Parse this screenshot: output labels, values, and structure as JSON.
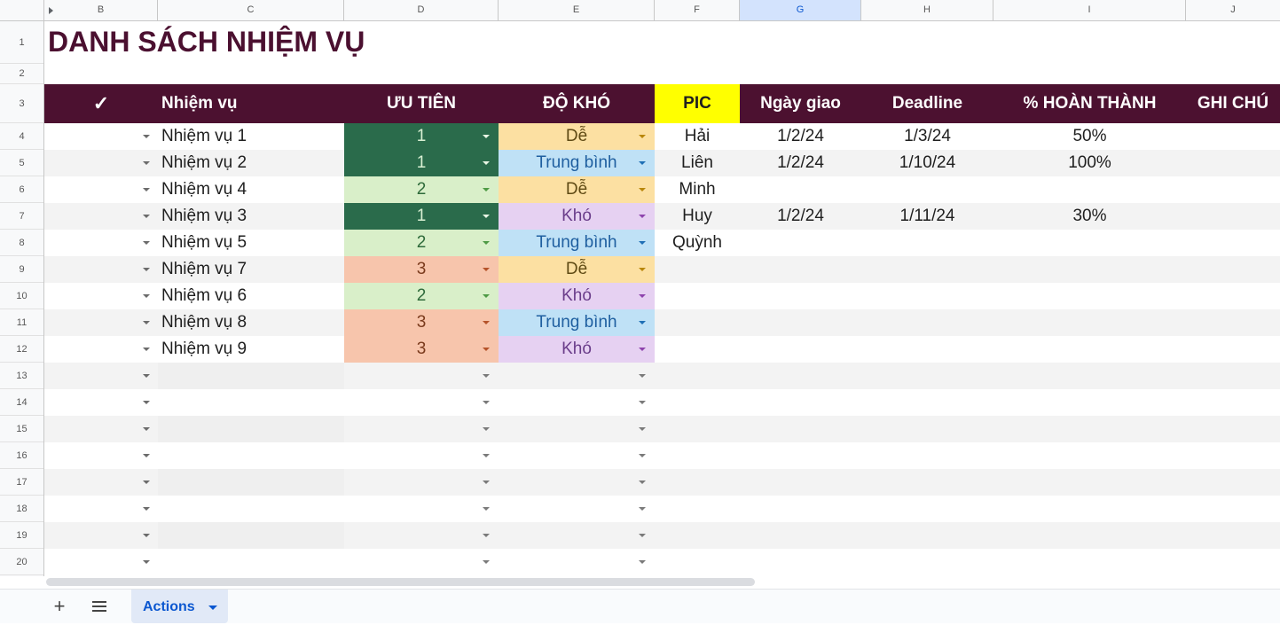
{
  "columns": [
    "B",
    "C",
    "D",
    "E",
    "F",
    "G",
    "H",
    "I",
    "J"
  ],
  "rows": [
    "1",
    "2",
    "3",
    "4",
    "5",
    "6",
    "7",
    "8",
    "9",
    "10",
    "11",
    "12",
    "13",
    "14",
    "15",
    "16",
    "17",
    "18",
    "19",
    "20"
  ],
  "title": "DANH SÁCH NHIỆM VỤ",
  "headers": {
    "check": "✓",
    "task": "Nhiệm vụ",
    "priority": "ƯU TIÊN",
    "difficulty": "ĐỘ KHÓ",
    "pic": "PIC",
    "assigned": "Ngày giao",
    "deadline": "Deadline",
    "percent": "% HOÀN THÀNH",
    "note": "GHI CHÚ"
  },
  "tasks": [
    {
      "name": "Nhiệm vụ 1",
      "priority": "1",
      "difficulty": "Dễ",
      "pic": "Hải",
      "assigned": "1/2/24",
      "deadline": "1/3/24",
      "percent": "50%"
    },
    {
      "name": "Nhiệm vụ 2",
      "priority": "1",
      "difficulty": "Trung bình",
      "pic": "Liên",
      "assigned": "1/2/24",
      "deadline": "1/10/24",
      "percent": "100%"
    },
    {
      "name": "Nhiệm vụ 4",
      "priority": "2",
      "difficulty": "Dễ",
      "pic": "Minh",
      "assigned": "",
      "deadline": "",
      "percent": ""
    },
    {
      "name": "Nhiệm vụ 3",
      "priority": "1",
      "difficulty": "Khó",
      "pic": "Huy",
      "assigned": "1/2/24",
      "deadline": "1/11/24",
      "percent": "30%"
    },
    {
      "name": "Nhiệm vụ 5",
      "priority": "2",
      "difficulty": "Trung bình",
      "pic": "Quỳnh",
      "assigned": "",
      "deadline": "",
      "percent": ""
    },
    {
      "name": "Nhiệm vụ 7",
      "priority": "3",
      "difficulty": "Dễ",
      "pic": "",
      "assigned": "",
      "deadline": "",
      "percent": ""
    },
    {
      "name": "Nhiệm vụ 6",
      "priority": "2",
      "difficulty": "Khó",
      "pic": "",
      "assigned": "",
      "deadline": "",
      "percent": ""
    },
    {
      "name": "Nhiệm vụ 8",
      "priority": "3",
      "difficulty": "Trung bình",
      "pic": "",
      "assigned": "",
      "deadline": "",
      "percent": ""
    },
    {
      "name": "Nhiệm vụ 9",
      "priority": "3",
      "difficulty": "Khó",
      "pic": "",
      "assigned": "",
      "deadline": "",
      "percent": ""
    }
  ],
  "colors": {
    "header_bg": "#4c1130",
    "pic_header_bg": "#ffff00",
    "priority": {
      "1": {
        "bg": "#2a6b4b",
        "fg": "#d9f0d3",
        "caret": "#e8f5e4"
      },
      "2": {
        "bg": "#d9efc9",
        "fg": "#2e6a3a",
        "caret": "#4e9a45"
      },
      "3": {
        "bg": "#f7c5ac",
        "fg": "#7a3a1c",
        "caret": "#b5532a"
      }
    },
    "difficulty": {
      "Dễ": {
        "bg": "#fce0a2",
        "fg": "#5f4a14",
        "caret": "#b8860b"
      },
      "Trung bình": {
        "bg": "#bfe1f6",
        "fg": "#1f5fa0",
        "caret": "#1f6fb5"
      },
      "Khó": {
        "bg": "#e6d1f2",
        "fg": "#6a3d8a",
        "caret": "#8e44ad"
      }
    }
  },
  "sheet_tabs": [
    {
      "label": "Actions",
      "active": true
    }
  ],
  "icons": {
    "add": "plus-icon",
    "menu": "all-sheets-icon"
  }
}
